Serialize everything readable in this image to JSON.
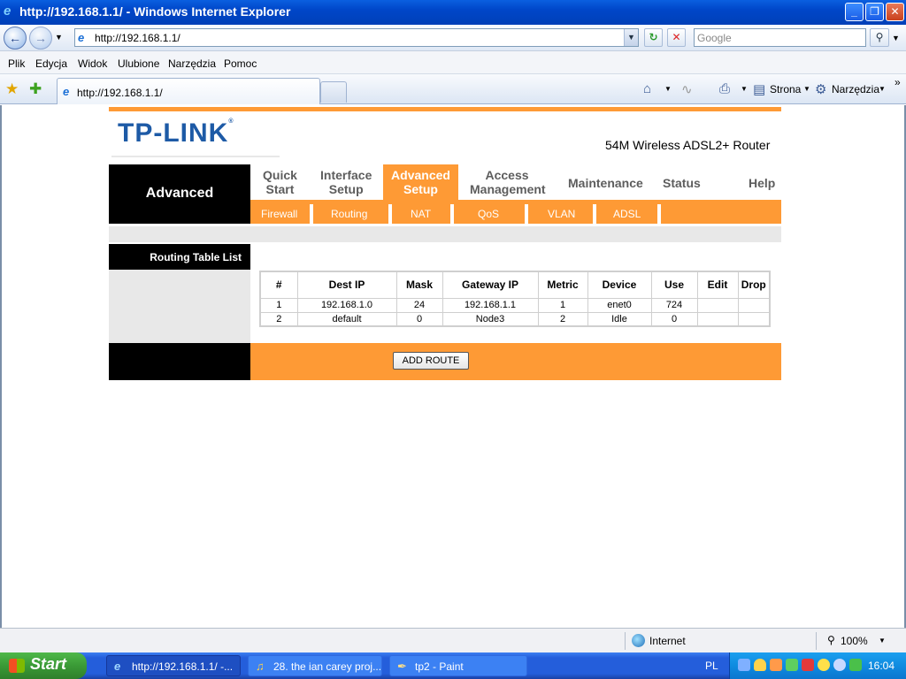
{
  "window": {
    "title": "http://192.168.1.1/ - Windows Internet Explorer",
    "minimize": "_",
    "restore": "❐",
    "close": "✕"
  },
  "address_bar": {
    "url": "http://192.168.1.1/",
    "search_placeholder": "Google"
  },
  "menu": [
    "Plik",
    "Edycja",
    "Widok",
    "Ulubione",
    "Narzędzia",
    "Pomoc"
  ],
  "tab": {
    "label": "http://192.168.1.1/"
  },
  "commands": {
    "page": "Strona",
    "tools": "Narzędzia"
  },
  "router": {
    "brand": "TP-LINK",
    "reg_mark": "®",
    "model": "54M Wireless ADSL2+ Router",
    "section": "Advanced",
    "nav": [
      {
        "line1": "Quick",
        "line2": "Start"
      },
      {
        "line1": "Interface",
        "line2": "Setup"
      },
      {
        "line1": "Advanced",
        "line2": "Setup"
      },
      {
        "line1": "Access",
        "line2": "Management"
      },
      {
        "line1": "Maintenance",
        "line2": ""
      },
      {
        "line1": "Status",
        "line2": ""
      },
      {
        "line1": "Help",
        "line2": ""
      }
    ],
    "subnav": [
      "Firewall",
      "Routing",
      "NAT",
      "QoS",
      "VLAN",
      "ADSL"
    ],
    "side_heading": "Routing Table List",
    "table": {
      "headers": [
        "#",
        "Dest IP",
        "Mask",
        "Gateway IP",
        "Metric",
        "Device",
        "Use",
        "Edit",
        "Drop"
      ],
      "rows": [
        [
          "1",
          "192.168.1.0",
          "24",
          "192.168.1.1",
          "1",
          "enet0",
          "724",
          "",
          ""
        ],
        [
          "2",
          "default",
          "0",
          "Node3",
          "2",
          "Idle",
          "0",
          "",
          ""
        ]
      ]
    },
    "add_route_label": "ADD ROUTE",
    "colors": {
      "orange": "#fe9a35",
      "logo_blue": "#1d5aa6"
    }
  },
  "statusbar": {
    "zone": "Internet",
    "zoom": "100%"
  },
  "taskbar": {
    "start": "Start",
    "tasks": [
      "http://192.168.1.1/ -...",
      "28. the ian carey proj...",
      "tp2 - Paint"
    ],
    "lang": "PL",
    "clock": "16:04"
  }
}
